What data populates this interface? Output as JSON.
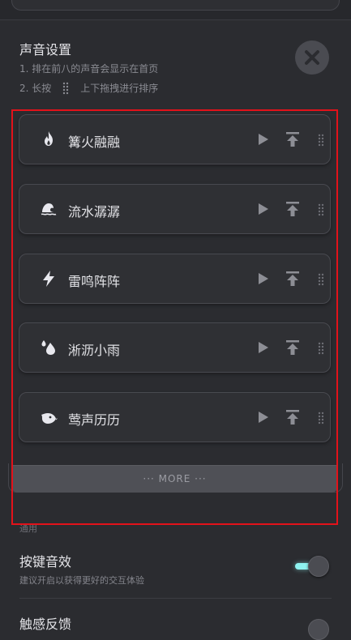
{
  "header": {
    "title": "声音设置",
    "hint1": "1. 排在前八的声音会显示在首页",
    "hint2_prefix": "2. 长按",
    "hint2_suffix": "上下拖拽进行排序"
  },
  "sounds": [
    {
      "label": "篝火融融",
      "icon": "flame-icon"
    },
    {
      "label": "流水潺潺",
      "icon": "water-icon"
    },
    {
      "label": "雷鸣阵阵",
      "icon": "lightning-icon"
    },
    {
      "label": "淅沥小雨",
      "icon": "raindrop-icon"
    },
    {
      "label": "莺声历历",
      "icon": "bird-icon"
    }
  ],
  "more_label": "··· MORE ···",
  "general": {
    "section_label": "通用",
    "key_sound_title": "按键音效",
    "key_sound_sub": "建议开启以获得更好的交互体验",
    "key_sound_on": true,
    "haptic_title": "触感反馈"
  },
  "colors": {
    "background": "#2b2c30",
    "card": "#2f3034",
    "toggle_accent": "#8ff3f0",
    "highlight_box": "#e3121a"
  }
}
